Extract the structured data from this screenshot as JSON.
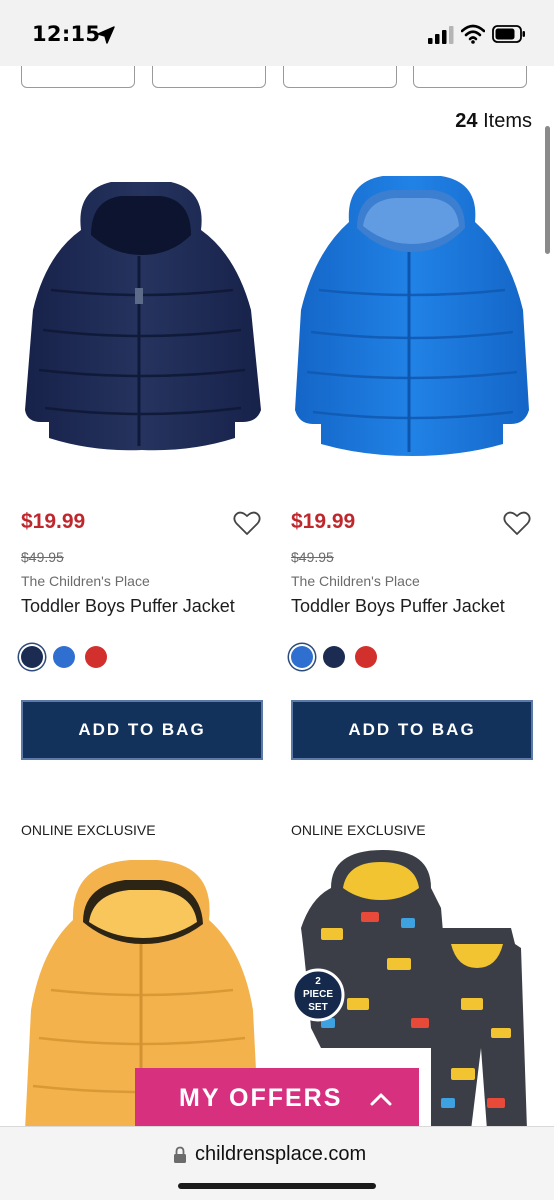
{
  "status_bar": {
    "time": "12:15"
  },
  "listing": {
    "count": "24",
    "count_label": "Items"
  },
  "products": [
    {
      "price": "$19.99",
      "original_price": "$49.95",
      "brand": "The Children's Place",
      "name": "Toddler Boys Puffer Jacket",
      "swatches": [
        "#1c2b52",
        "#2f6fd0",
        "#d2302d"
      ],
      "selected_swatch": 0,
      "button": "ADD TO BAG",
      "color": "#1c2b52"
    },
    {
      "price": "$19.99",
      "original_price": "$49.95",
      "brand": "The Children's Place",
      "name": "Toddler Boys Puffer Jacket",
      "swatches": [
        "#2f6fd0",
        "#1c2b52",
        "#d2302d"
      ],
      "selected_swatch": 0,
      "button": "ADD TO BAG",
      "color": "#1f74d9"
    },
    {
      "badge": "ONLINE EXCLUSIVE",
      "color": "#f5b44e"
    },
    {
      "badge": "ONLINE EXCLUSIVE",
      "set_badge_line1": "2",
      "set_badge_line2": "PIECE",
      "set_badge_line3": "SET"
    }
  ],
  "offers": {
    "label": "MY OFFERS"
  },
  "address_bar": {
    "domain": "childrensplace.com"
  },
  "colors": {
    "sale_red": "#c0272d",
    "button_navy": "#12325c",
    "offers_pink": "#d7307f"
  }
}
